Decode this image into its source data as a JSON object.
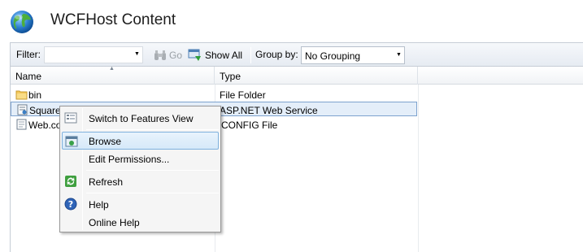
{
  "header": {
    "title": "WCFHost Content",
    "icon": "globe-icon"
  },
  "toolbar": {
    "filter_label": "Filter:",
    "filter_value": "",
    "go_label": "Go",
    "show_all_label": "Show All",
    "group_by_label": "Group by:",
    "group_by_value": "No Grouping"
  },
  "list": {
    "columns": [
      "Name",
      "Type"
    ],
    "rows": [
      {
        "name": "bin",
        "type": "File Folder",
        "icon": "folder-icon"
      },
      {
        "name": "SquareS",
        "type": "ASP.NET Web Service",
        "icon": "service-file-icon"
      },
      {
        "name": "Web.co",
        "type": "CONFIG File",
        "icon": "config-file-icon"
      }
    ]
  },
  "context_menu": {
    "items": [
      {
        "label": "Switch to Features View",
        "icon": "features-view-icon"
      },
      {
        "label": "Browse",
        "icon": "browse-icon",
        "highlighted": true
      },
      {
        "label": "Edit Permissions...",
        "icon": ""
      },
      {
        "label": "Refresh",
        "icon": "refresh-icon"
      },
      {
        "label": "Help",
        "icon": "help-icon"
      },
      {
        "label": "Online Help",
        "icon": ""
      }
    ]
  },
  "colors": {
    "selection_bg": "#e4eef9",
    "selection_border": "#7da2ce",
    "menu_hover_border": "#7fb1dd"
  }
}
